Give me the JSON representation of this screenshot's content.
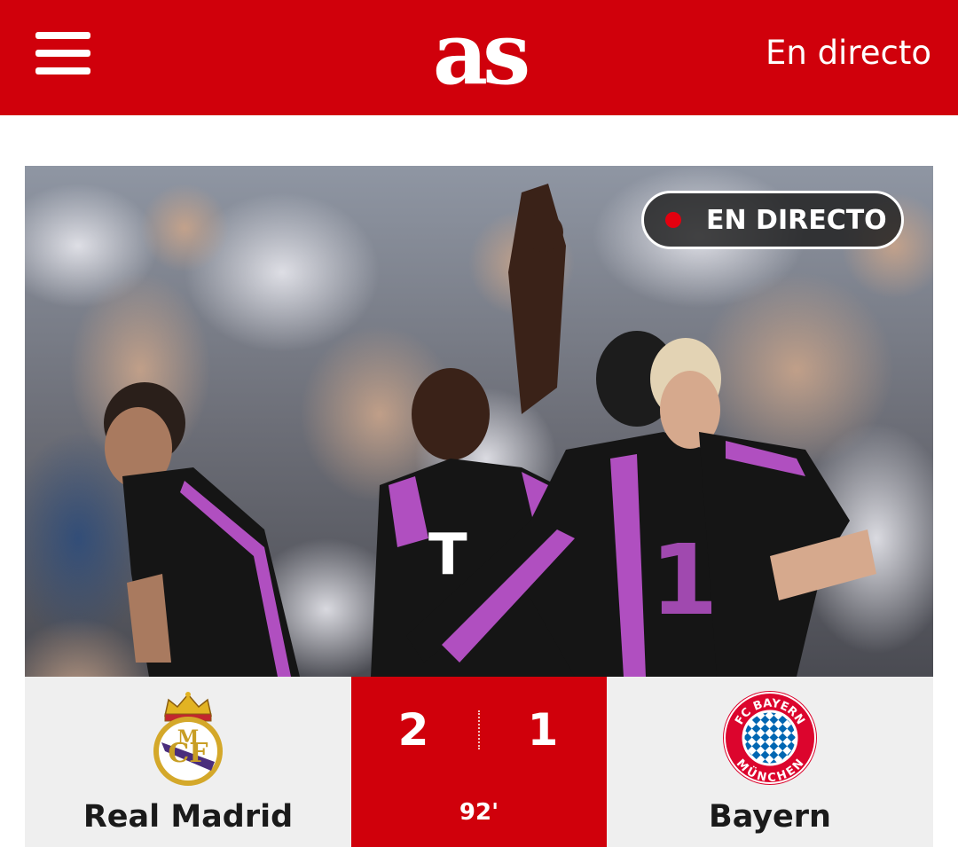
{
  "header": {
    "logo_text": "as",
    "live_link_label": "En directo",
    "menu_icon": "hamburger-menu-icon",
    "background_color": "#d0000b"
  },
  "hero": {
    "badge_label": "EN DIRECTO",
    "badge_dot_color": "#e3000f",
    "image_description_icon": "match-photo"
  },
  "match": {
    "home_team": "Real Madrid",
    "away_team": "Bayern",
    "home_score": "2",
    "away_score": "1",
    "minute": "92'",
    "home_crest_icon": "real-madrid-crest-icon",
    "away_crest_icon": "bayern-munich-crest-icon",
    "away_crest_text_top": "FC BAYERN",
    "away_crest_text_bottom": "MÜNCHEN",
    "accent_color": "#d0000b"
  }
}
